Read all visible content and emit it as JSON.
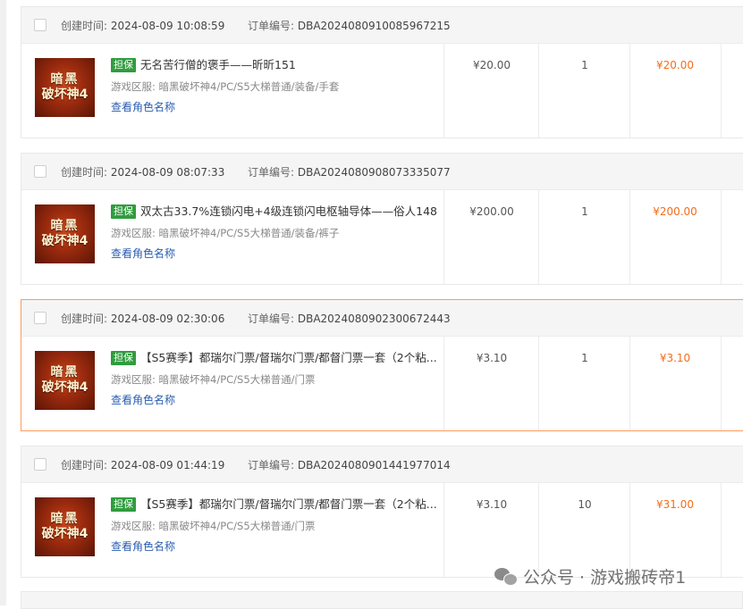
{
  "labels": {
    "created_time": "创建时间:",
    "order_no": "订单编号:",
    "guarantee_badge": "担保",
    "region_prefix": "游戏区服:",
    "view_role": "查看角色名称"
  },
  "product_image": {
    "line1": "暗黑",
    "line2": "破坏神4"
  },
  "orders": [
    {
      "created": "2024-08-09 10:08:59",
      "order_no": "DBA2024080910085967215",
      "title": "无名苦行僧的褒手——昕昕151",
      "region": "暗黑破坏神4/PC/S5大梯普通/装备/手套",
      "price": "¥20.00",
      "qty": "1",
      "total": "¥20.00"
    },
    {
      "created": "2024-08-09 08:07:33",
      "order_no": "DBA2024080908073335077",
      "title": "双太古33.7%连锁闪电+4级连锁闪电枢轴导体——俗人148",
      "region": "暗黑破坏神4/PC/S5大梯普通/装备/裤子",
      "price": "¥200.00",
      "qty": "1",
      "total": "¥200.00"
    },
    {
      "created": "2024-08-09 02:30:06",
      "order_no": "DBA2024080902300672443",
      "title": "【S5赛季】都瑞尔门票/督瑞尔门票/都督门票一套（2个粘...",
      "region": "暗黑破坏神4/PC/S5大梯普通/门票",
      "price": "¥3.10",
      "qty": "1",
      "total": "¥3.10"
    },
    {
      "created": "2024-08-09 01:44:19",
      "order_no": "DBA2024080901441977014",
      "title": "【S5赛季】都瑞尔门票/督瑞尔门票/都督门票一套（2个粘...",
      "region": "暗黑破坏神4/PC/S5大梯普通/门票",
      "price": "¥3.10",
      "qty": "10",
      "total": "¥31.00"
    }
  ],
  "watermark": {
    "text": "公众号 · 游戏搬砖帝1",
    "icon": "wechat-icon"
  },
  "colors": {
    "accent_price": "#f36d1b",
    "badge": "#2f9c3e",
    "link": "#2a5db0",
    "active_border": "#ff9a5a"
  }
}
